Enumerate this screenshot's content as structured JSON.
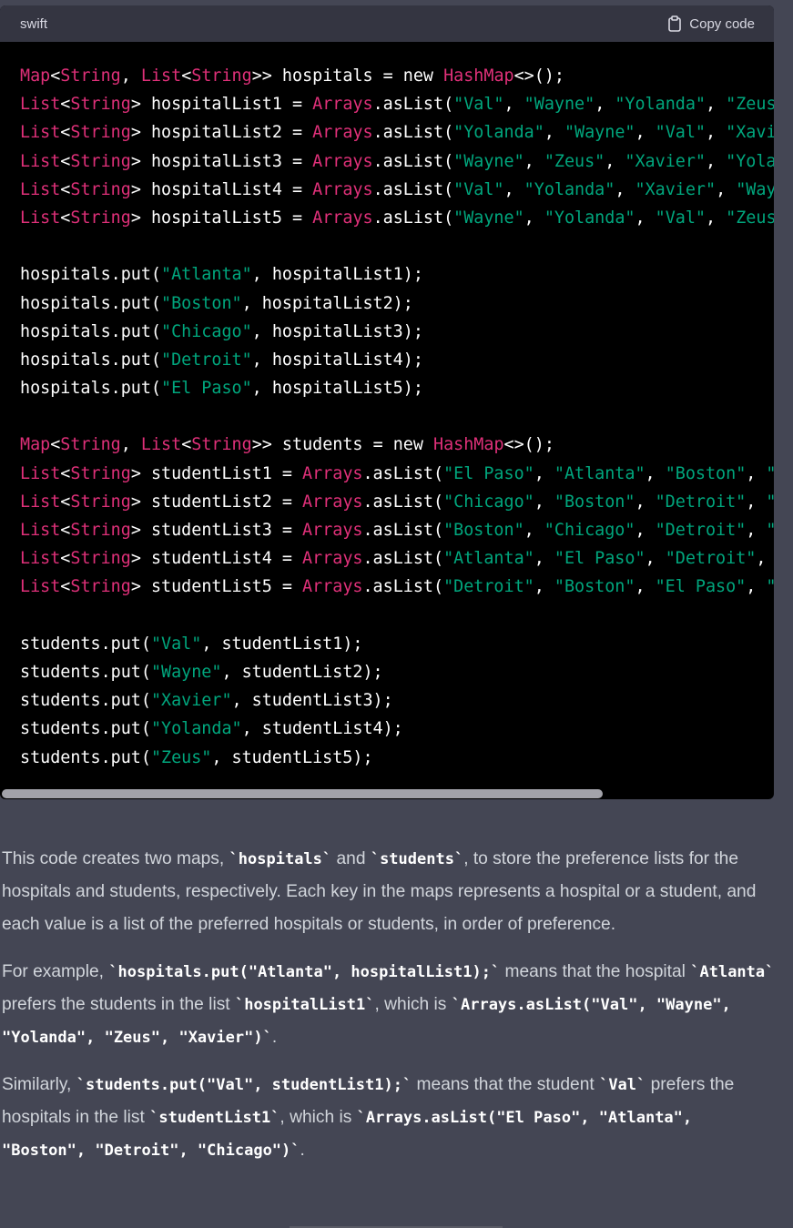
{
  "code_block": {
    "language": "swift",
    "copy_label": "Copy code",
    "icons": {
      "copy": "clipboard-icon"
    },
    "colors": {
      "keyword": "#df3079",
      "string": "#00a67d",
      "text": "#ffffff"
    },
    "lines": [
      {
        "segments": [
          {
            "t": "kw",
            "v": "Map"
          },
          {
            "t": "p",
            "v": "<"
          },
          {
            "t": "kw",
            "v": "String"
          },
          {
            "t": "p",
            "v": ", "
          },
          {
            "t": "kw",
            "v": "List"
          },
          {
            "t": "p",
            "v": "<"
          },
          {
            "t": "kw",
            "v": "String"
          },
          {
            "t": "p",
            "v": ">> hospitals = new "
          },
          {
            "t": "kw",
            "v": "HashMap"
          },
          {
            "t": "p",
            "v": "<>();"
          }
        ]
      },
      {
        "segments": [
          {
            "t": "kw",
            "v": "List"
          },
          {
            "t": "p",
            "v": "<"
          },
          {
            "t": "kw",
            "v": "String"
          },
          {
            "t": "p",
            "v": "> hospitalList1 = "
          },
          {
            "t": "kw",
            "v": "Arrays"
          },
          {
            "t": "p",
            "v": ".asList("
          },
          {
            "t": "str",
            "v": "\"Val\""
          },
          {
            "t": "p",
            "v": ", "
          },
          {
            "t": "str",
            "v": "\"Wayne\""
          },
          {
            "t": "p",
            "v": ", "
          },
          {
            "t": "str",
            "v": "\"Yolanda\""
          },
          {
            "t": "p",
            "v": ", "
          },
          {
            "t": "str",
            "v": "\"Zeus\""
          }
        ]
      },
      {
        "segments": [
          {
            "t": "kw",
            "v": "List"
          },
          {
            "t": "p",
            "v": "<"
          },
          {
            "t": "kw",
            "v": "String"
          },
          {
            "t": "p",
            "v": "> hospitalList2 = "
          },
          {
            "t": "kw",
            "v": "Arrays"
          },
          {
            "t": "p",
            "v": ".asList("
          },
          {
            "t": "str",
            "v": "\"Yolanda\""
          },
          {
            "t": "p",
            "v": ", "
          },
          {
            "t": "str",
            "v": "\"Wayne\""
          },
          {
            "t": "p",
            "v": ", "
          },
          {
            "t": "str",
            "v": "\"Val\""
          },
          {
            "t": "p",
            "v": ", "
          },
          {
            "t": "str",
            "v": "\"Xavie"
          }
        ]
      },
      {
        "segments": [
          {
            "t": "kw",
            "v": "List"
          },
          {
            "t": "p",
            "v": "<"
          },
          {
            "t": "kw",
            "v": "String"
          },
          {
            "t": "p",
            "v": "> hospitalList3 = "
          },
          {
            "t": "kw",
            "v": "Arrays"
          },
          {
            "t": "p",
            "v": ".asList("
          },
          {
            "t": "str",
            "v": "\"Wayne\""
          },
          {
            "t": "p",
            "v": ", "
          },
          {
            "t": "str",
            "v": "\"Zeus\""
          },
          {
            "t": "p",
            "v": ", "
          },
          {
            "t": "str",
            "v": "\"Xavier\""
          },
          {
            "t": "p",
            "v": ", "
          },
          {
            "t": "str",
            "v": "\"Yolan"
          }
        ]
      },
      {
        "segments": [
          {
            "t": "kw",
            "v": "List"
          },
          {
            "t": "p",
            "v": "<"
          },
          {
            "t": "kw",
            "v": "String"
          },
          {
            "t": "p",
            "v": "> hospitalList4 = "
          },
          {
            "t": "kw",
            "v": "Arrays"
          },
          {
            "t": "p",
            "v": ".asList("
          },
          {
            "t": "str",
            "v": "\"Val\""
          },
          {
            "t": "p",
            "v": ", "
          },
          {
            "t": "str",
            "v": "\"Yolanda\""
          },
          {
            "t": "p",
            "v": ", "
          },
          {
            "t": "str",
            "v": "\"Xavier\""
          },
          {
            "t": "p",
            "v": ", "
          },
          {
            "t": "str",
            "v": "\"Wayn"
          }
        ]
      },
      {
        "segments": [
          {
            "t": "kw",
            "v": "List"
          },
          {
            "t": "p",
            "v": "<"
          },
          {
            "t": "kw",
            "v": "String"
          },
          {
            "t": "p",
            "v": "> hospitalList5 = "
          },
          {
            "t": "kw",
            "v": "Arrays"
          },
          {
            "t": "p",
            "v": ".asList("
          },
          {
            "t": "str",
            "v": "\"Wayne\""
          },
          {
            "t": "p",
            "v": ", "
          },
          {
            "t": "str",
            "v": "\"Yolanda\""
          },
          {
            "t": "p",
            "v": ", "
          },
          {
            "t": "str",
            "v": "\"Val\""
          },
          {
            "t": "p",
            "v": ", "
          },
          {
            "t": "str",
            "v": "\"Zeus\""
          }
        ]
      },
      {
        "segments": []
      },
      {
        "segments": [
          {
            "t": "p",
            "v": "hospitals.put("
          },
          {
            "t": "str",
            "v": "\"Atlanta\""
          },
          {
            "t": "p",
            "v": ", hospitalList1);"
          }
        ]
      },
      {
        "segments": [
          {
            "t": "p",
            "v": "hospitals.put("
          },
          {
            "t": "str",
            "v": "\"Boston\""
          },
          {
            "t": "p",
            "v": ", hospitalList2);"
          }
        ]
      },
      {
        "segments": [
          {
            "t": "p",
            "v": "hospitals.put("
          },
          {
            "t": "str",
            "v": "\"Chicago\""
          },
          {
            "t": "p",
            "v": ", hospitalList3);"
          }
        ]
      },
      {
        "segments": [
          {
            "t": "p",
            "v": "hospitals.put("
          },
          {
            "t": "str",
            "v": "\"Detroit\""
          },
          {
            "t": "p",
            "v": ", hospitalList4);"
          }
        ]
      },
      {
        "segments": [
          {
            "t": "p",
            "v": "hospitals.put("
          },
          {
            "t": "str",
            "v": "\"El Paso\""
          },
          {
            "t": "p",
            "v": ", hospitalList5);"
          }
        ]
      },
      {
        "segments": []
      },
      {
        "segments": [
          {
            "t": "kw",
            "v": "Map"
          },
          {
            "t": "p",
            "v": "<"
          },
          {
            "t": "kw",
            "v": "String"
          },
          {
            "t": "p",
            "v": ", "
          },
          {
            "t": "kw",
            "v": "List"
          },
          {
            "t": "p",
            "v": "<"
          },
          {
            "t": "kw",
            "v": "String"
          },
          {
            "t": "p",
            "v": ">> students = new "
          },
          {
            "t": "kw",
            "v": "HashMap"
          },
          {
            "t": "p",
            "v": "<>();"
          }
        ]
      },
      {
        "segments": [
          {
            "t": "kw",
            "v": "List"
          },
          {
            "t": "p",
            "v": "<"
          },
          {
            "t": "kw",
            "v": "String"
          },
          {
            "t": "p",
            "v": "> studentList1 = "
          },
          {
            "t": "kw",
            "v": "Arrays"
          },
          {
            "t": "p",
            "v": ".asList("
          },
          {
            "t": "str",
            "v": "\"El Paso\""
          },
          {
            "t": "p",
            "v": ", "
          },
          {
            "t": "str",
            "v": "\"Atlanta\""
          },
          {
            "t": "p",
            "v": ", "
          },
          {
            "t": "str",
            "v": "\"Boston\""
          },
          {
            "t": "p",
            "v": ", "
          },
          {
            "t": "str",
            "v": "\"D"
          }
        ]
      },
      {
        "segments": [
          {
            "t": "kw",
            "v": "List"
          },
          {
            "t": "p",
            "v": "<"
          },
          {
            "t": "kw",
            "v": "String"
          },
          {
            "t": "p",
            "v": "> studentList2 = "
          },
          {
            "t": "kw",
            "v": "Arrays"
          },
          {
            "t": "p",
            "v": ".asList("
          },
          {
            "t": "str",
            "v": "\"Chicago\""
          },
          {
            "t": "p",
            "v": ", "
          },
          {
            "t": "str",
            "v": "\"Boston\""
          },
          {
            "t": "p",
            "v": ", "
          },
          {
            "t": "str",
            "v": "\"Detroit\""
          },
          {
            "t": "p",
            "v": ", "
          },
          {
            "t": "str",
            "v": "\"A"
          }
        ]
      },
      {
        "segments": [
          {
            "t": "kw",
            "v": "List"
          },
          {
            "t": "p",
            "v": "<"
          },
          {
            "t": "kw",
            "v": "String"
          },
          {
            "t": "p",
            "v": "> studentList3 = "
          },
          {
            "t": "kw",
            "v": "Arrays"
          },
          {
            "t": "p",
            "v": ".asList("
          },
          {
            "t": "str",
            "v": "\"Boston\""
          },
          {
            "t": "p",
            "v": ", "
          },
          {
            "t": "str",
            "v": "\"Chicago\""
          },
          {
            "t": "p",
            "v": ", "
          },
          {
            "t": "str",
            "v": "\"Detroit\""
          },
          {
            "t": "p",
            "v": ", "
          },
          {
            "t": "str",
            "v": "\"E"
          }
        ]
      },
      {
        "segments": [
          {
            "t": "kw",
            "v": "List"
          },
          {
            "t": "p",
            "v": "<"
          },
          {
            "t": "kw",
            "v": "String"
          },
          {
            "t": "p",
            "v": "> studentList4 = "
          },
          {
            "t": "kw",
            "v": "Arrays"
          },
          {
            "t": "p",
            "v": ".asList("
          },
          {
            "t": "str",
            "v": "\"Atlanta\""
          },
          {
            "t": "p",
            "v": ", "
          },
          {
            "t": "str",
            "v": "\"El Paso\""
          },
          {
            "t": "p",
            "v": ", "
          },
          {
            "t": "str",
            "v": "\"Detroit\""
          },
          {
            "t": "p",
            "v": ", "
          },
          {
            "t": "str",
            "v": "\""
          }
        ]
      },
      {
        "segments": [
          {
            "t": "kw",
            "v": "List"
          },
          {
            "t": "p",
            "v": "<"
          },
          {
            "t": "kw",
            "v": "String"
          },
          {
            "t": "p",
            "v": "> studentList5 = "
          },
          {
            "t": "kw",
            "v": "Arrays"
          },
          {
            "t": "p",
            "v": ".asList("
          },
          {
            "t": "str",
            "v": "\"Detroit\""
          },
          {
            "t": "p",
            "v": ", "
          },
          {
            "t": "str",
            "v": "\"Boston\""
          },
          {
            "t": "p",
            "v": ", "
          },
          {
            "t": "str",
            "v": "\"El Paso\""
          },
          {
            "t": "p",
            "v": ", "
          },
          {
            "t": "str",
            "v": "\"C"
          }
        ]
      },
      {
        "segments": []
      },
      {
        "segments": [
          {
            "t": "p",
            "v": "students.put("
          },
          {
            "t": "str",
            "v": "\"Val\""
          },
          {
            "t": "p",
            "v": ", studentList1);"
          }
        ]
      },
      {
        "segments": [
          {
            "t": "p",
            "v": "students.put("
          },
          {
            "t": "str",
            "v": "\"Wayne\""
          },
          {
            "t": "p",
            "v": ", studentList2);"
          }
        ]
      },
      {
        "segments": [
          {
            "t": "p",
            "v": "students.put("
          },
          {
            "t": "str",
            "v": "\"Xavier\""
          },
          {
            "t": "p",
            "v": ", studentList3);"
          }
        ]
      },
      {
        "segments": [
          {
            "t": "p",
            "v": "students.put("
          },
          {
            "t": "str",
            "v": "\"Yolanda\""
          },
          {
            "t": "p",
            "v": ", studentList4);"
          }
        ]
      },
      {
        "segments": [
          {
            "t": "p",
            "v": "students.put("
          },
          {
            "t": "str",
            "v": "\"Zeus\""
          },
          {
            "t": "p",
            "v": ", studentList5);"
          }
        ]
      }
    ]
  },
  "prose": {
    "paragraphs": [
      {
        "parts": [
          {
            "t": "text",
            "v": "This code creates two maps, "
          },
          {
            "t": "code",
            "v": "`hospitals`"
          },
          {
            "t": "text",
            "v": " and "
          },
          {
            "t": "code",
            "v": "`students`"
          },
          {
            "t": "text",
            "v": ", to store the preference lists for the hospitals and students, respectively. Each key in the maps represents a hospital or a student, and each value is a list of the preferred hospitals or students, in order of preference."
          }
        ]
      },
      {
        "parts": [
          {
            "t": "text",
            "v": "For example, "
          },
          {
            "t": "code",
            "v": "`hospitals.put(\"Atlanta\", hospitalList1);`"
          },
          {
            "t": "text",
            "v": " means that the hospital "
          },
          {
            "t": "code",
            "v": "`Atlanta`"
          },
          {
            "t": "text",
            "v": " prefers the students in the list "
          },
          {
            "t": "code",
            "v": "`hospitalList1`"
          },
          {
            "t": "text",
            "v": ", which is "
          },
          {
            "t": "code",
            "v": "`Arrays.asList(\"Val\", \"Wayne\", \"Yolanda\", \"Zeus\", \"Xavier\")`"
          },
          {
            "t": "text",
            "v": "."
          }
        ]
      },
      {
        "parts": [
          {
            "t": "text",
            "v": "Similarly, "
          },
          {
            "t": "code",
            "v": "`students.put(\"Val\", studentList1);`"
          },
          {
            "t": "text",
            "v": " means that the student "
          },
          {
            "t": "code",
            "v": "`Val`"
          },
          {
            "t": "text",
            "v": " prefers the hospitals in the list "
          },
          {
            "t": "code",
            "v": "`studentList1`"
          },
          {
            "t": "text",
            "v": ", which is "
          },
          {
            "t": "code",
            "v": "`Arrays.asList(\"El Paso\", \"Atlanta\", \"Boston\", \"Detroit\", \"Chicago\")`"
          },
          {
            "t": "text",
            "v": "."
          }
        ]
      }
    ]
  }
}
